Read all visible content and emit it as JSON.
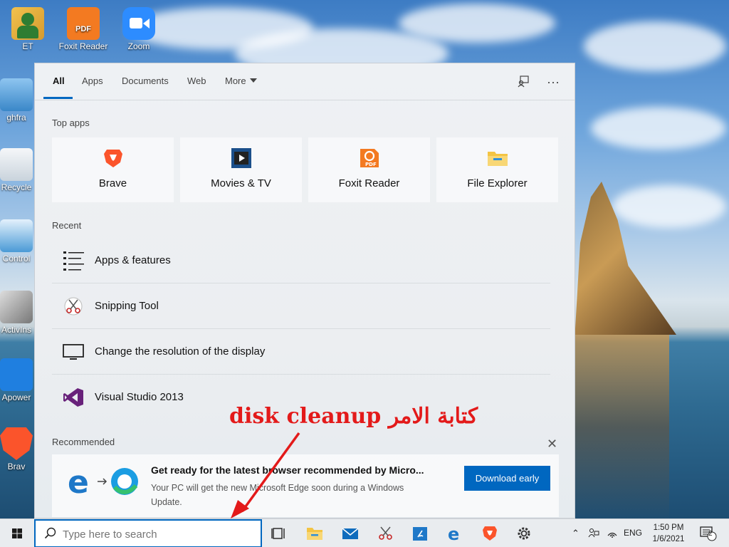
{
  "desktop": {
    "icons": [
      {
        "label": "ET",
        "icon": "user-folder-icon"
      },
      {
        "label": "Foxit Reader",
        "icon": "foxit-pdf-icon"
      },
      {
        "label": "Zoom",
        "icon": "zoom-camera-icon"
      },
      {
        "label": "ghfra",
        "icon": "computer-icon"
      },
      {
        "label": "Recycle",
        "icon": "recycle-bin-icon"
      },
      {
        "label": "Control",
        "icon": "control-panel-icon"
      },
      {
        "label": "ActivIns",
        "icon": "activinspire-icon"
      },
      {
        "label": "Apower",
        "icon": "apowersoft-icon"
      },
      {
        "label": "Brav",
        "icon": "brave-icon"
      }
    ]
  },
  "panel": {
    "tabs": [
      {
        "label": "All",
        "active": true
      },
      {
        "label": "Apps"
      },
      {
        "label": "Documents"
      },
      {
        "label": "Web"
      },
      {
        "label": "More"
      }
    ],
    "top_apps_title": "Top apps",
    "top_apps": [
      {
        "label": "Brave",
        "icon": "brave-icon"
      },
      {
        "label": "Movies & TV",
        "icon": "movies-tv-icon"
      },
      {
        "label": "Foxit Reader",
        "icon": "foxit-pdf-icon"
      },
      {
        "label": "File Explorer",
        "icon": "folder-icon"
      }
    ],
    "recent_title": "Recent",
    "recent": [
      {
        "label": "Apps & features",
        "icon": "apps-list-icon"
      },
      {
        "label": "Snipping Tool",
        "icon": "scissors-icon"
      },
      {
        "label": "Change the resolution of the display",
        "icon": "monitor-icon"
      },
      {
        "label": "Visual Studio 2013",
        "icon": "visual-studio-icon"
      }
    ],
    "recommended_title": "Recommended",
    "recommended": {
      "title": "Get ready for the latest browser recommended by Micro...",
      "description": "Your PC will get the new Microsoft Edge soon during a Windows Update.",
      "button": "Download early"
    }
  },
  "annotation": {
    "text": "disk cleanup  كتابة الامر",
    "color": "#e31a1a"
  },
  "taskbar": {
    "search_placeholder": "Type here to search",
    "language": "ENG",
    "time": "1:50 PM",
    "date": "1/6/2021",
    "notification_count": "2"
  },
  "colors": {
    "accent": "#0067c0",
    "annotation": "#e31a1a"
  }
}
